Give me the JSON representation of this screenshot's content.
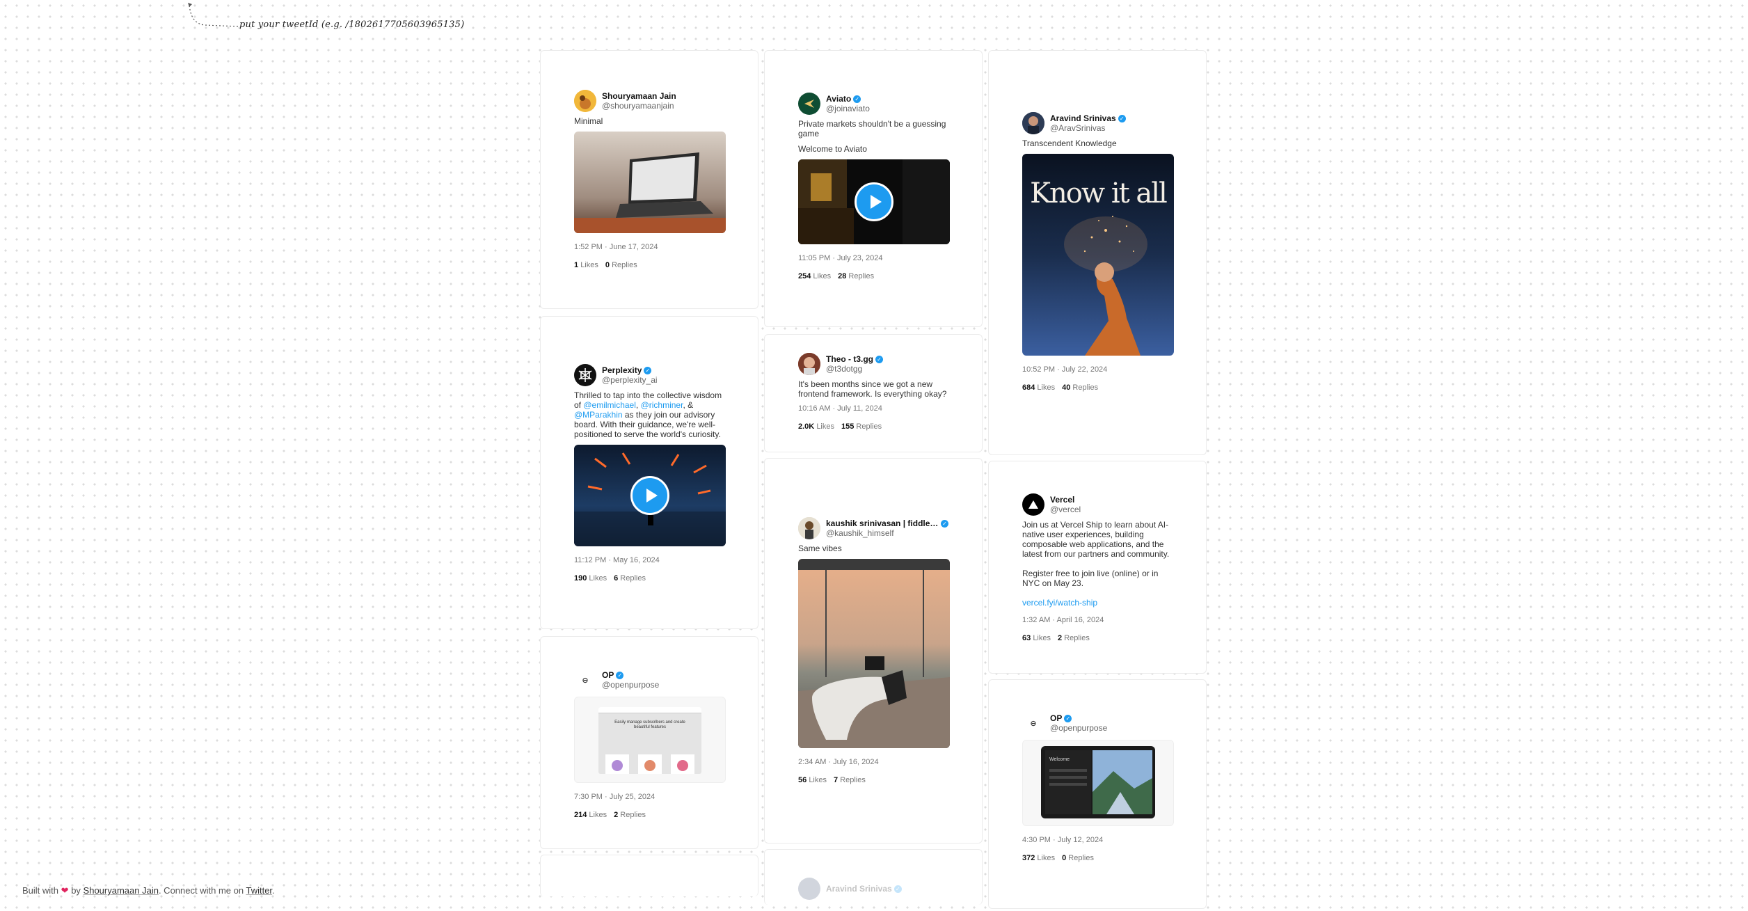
{
  "hint": {
    "text": "put your tweetId (e.g. /1802617705603965135)"
  },
  "tweets": {
    "shouryamaan": {
      "name": "Shouryamaan Jain",
      "handle": "@shouryamaanjain",
      "text": "Minimal",
      "time": "1:52 PM · June 17, 2024",
      "likes": "1",
      "replies": "0"
    },
    "aviato": {
      "name": "Aviato",
      "handle": "@joinaviato",
      "text1": "Private markets shouldn't be a guessing game",
      "text2": "Welcome to Aviato",
      "time": "11:05 PM · July 23, 2024",
      "likes": "254",
      "replies": "28"
    },
    "aravind": {
      "name": "Aravind Srinivas",
      "handle": "@AravSrinivas",
      "text": "Transcendent Knowledge",
      "image_caption": "Know it all",
      "time": "10:52 PM · July 22, 2024",
      "likes": "684",
      "replies": "40"
    },
    "perplexity": {
      "name": "Perplexity",
      "handle": "@perplexity_ai",
      "text_a": "Thrilled to tap into the collective wisdom of ",
      "m1": "@emilmichael",
      "sep1": ", ",
      "m2": "@richminer",
      "sep2": ", & ",
      "m3": "@MParakhin",
      "text_b": " as they join our advisory board. With their guidance, we're well-positioned to serve the world's curiosity.",
      "time": "11:12 PM · May 16, 2024",
      "likes": "190",
      "replies": "6"
    },
    "theo": {
      "name": "Theo - t3.gg",
      "handle": "@t3dotgg",
      "text": "It's been months since we got a new frontend framework. Is everything okay?",
      "time": "10:16 AM · July 11, 2024",
      "likes": "2.0K",
      "replies": "155"
    },
    "vercel": {
      "name": "Vercel",
      "handle": "@vercel",
      "text1": "Join us at Vercel Ship to learn about AI-native user experiences, building composable web applications, and the latest from our partners and community.",
      "text2": "Register free to join live (online) or in NYC on May 23.",
      "link": "vercel.fyi/watch-ship",
      "time": "1:32 AM · April 16, 2024",
      "likes": "63",
      "replies": "2"
    },
    "kaushik": {
      "name": "kaushik srinivasan | fiddlecub...",
      "handle": "@kaushik_himself",
      "text": "Same vibes",
      "time": "2:34 AM · July 16, 2024",
      "likes": "56",
      "replies": "7"
    },
    "op1": {
      "name": "OP",
      "handle": "@openpurpose",
      "preview_title": "Easily manage subscribers and create beautiful features",
      "time": "7:30 PM · July 25, 2024",
      "likes": "214",
      "replies": "2"
    },
    "op2": {
      "name": "OP",
      "handle": "@openpurpose",
      "preview_title": "Welcome",
      "time": "4:30 PM · July 12, 2024",
      "likes": "372",
      "replies": "0"
    },
    "aravind2": {
      "name": "Aravind Srinivas"
    }
  },
  "labels": {
    "likes": "Likes",
    "replies": "Replies"
  },
  "footer": {
    "built_with": "Built with",
    "by": "by",
    "author": "Shouryamaan Jain",
    "connect": ". Connect with me on",
    "twitter": "Twitter",
    "end": "."
  },
  "icons": {
    "verified": "verified-badge-icon",
    "heart": "heart-icon",
    "play": "play-icon"
  },
  "colors": {
    "accent": "#1d9bf0",
    "heart": "#e0245e"
  }
}
